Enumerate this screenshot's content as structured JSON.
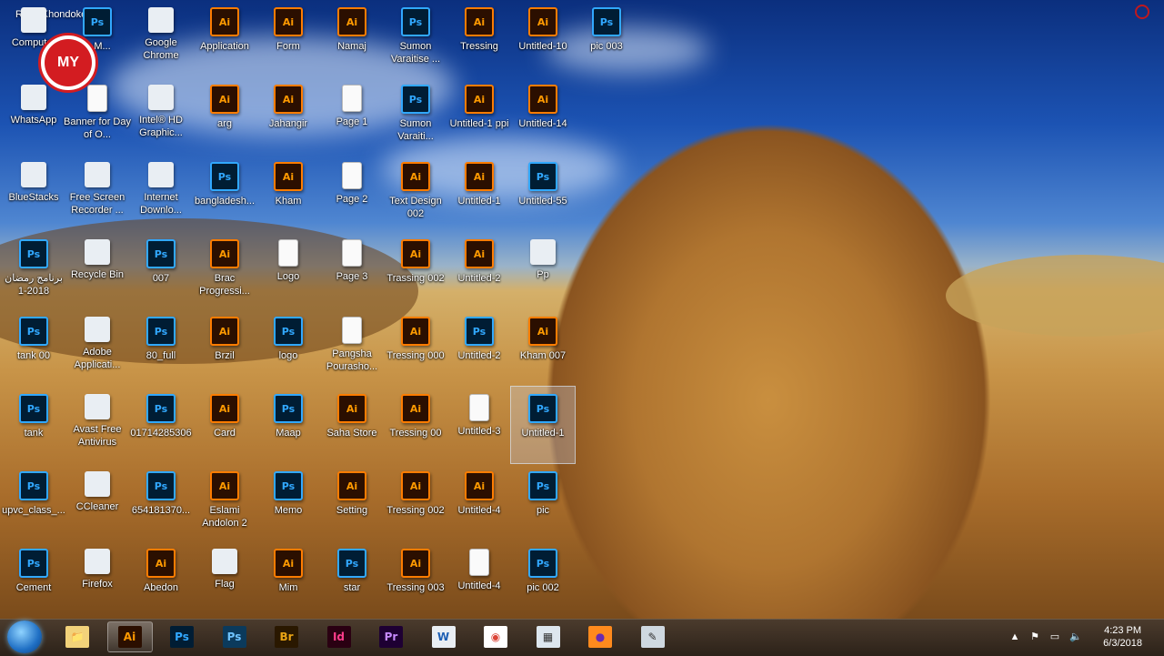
{
  "desktop": {
    "user_name": "Rony Khondoker",
    "badge_text": "MY",
    "icons": [
      {
        "label": "Computer",
        "type": "app"
      },
      {
        "label": "A-M...",
        "type": "ps"
      },
      {
        "label": "Google Chrome",
        "type": "app"
      },
      {
        "label": "Application",
        "type": "ai"
      },
      {
        "label": "Form",
        "type": "ai"
      },
      {
        "label": "Namaj",
        "type": "ai"
      },
      {
        "label": "Sumon Varaitise ...",
        "type": "ps"
      },
      {
        "label": "Tressing",
        "type": "ai"
      },
      {
        "label": "Untitled-10",
        "type": "ai"
      },
      {
        "label": "pic 003",
        "type": "ps"
      },
      {
        "label": "WhatsApp",
        "type": "app"
      },
      {
        "label": "Banner for Day of O...",
        "type": "doc"
      },
      {
        "label": "Intel® HD Graphic...",
        "type": "app"
      },
      {
        "label": "arg",
        "type": "ai"
      },
      {
        "label": "Jahangir",
        "type": "ai"
      },
      {
        "label": "Page 1",
        "type": "doc"
      },
      {
        "label": "Sumon Varaiti...",
        "type": "ps"
      },
      {
        "label": "Untitled-1 ppi",
        "type": "ai"
      },
      {
        "label": "Untitled-14",
        "type": "ai"
      },
      {
        "label": "BlueStacks",
        "type": "app"
      },
      {
        "label": "Free Screen Recorder ...",
        "type": "app"
      },
      {
        "label": "Internet Downlo...",
        "type": "app"
      },
      {
        "label": "bangladesh...",
        "type": "ps"
      },
      {
        "label": "Kham",
        "type": "ai"
      },
      {
        "label": "Page 2",
        "type": "doc"
      },
      {
        "label": "Text Design 002",
        "type": "ai"
      },
      {
        "label": "Untitled-1",
        "type": "ai"
      },
      {
        "label": "Untitled-55",
        "type": "ps"
      },
      {
        "label": "برنامج رمضان 2018-1",
        "type": "ps"
      },
      {
        "label": "Recycle Bin",
        "type": "app"
      },
      {
        "label": "007",
        "type": "ps"
      },
      {
        "label": "Brac Progressi...",
        "type": "ai"
      },
      {
        "label": "Logo",
        "type": "doc"
      },
      {
        "label": "Page 3",
        "type": "doc"
      },
      {
        "label": "Trassing 002",
        "type": "ai"
      },
      {
        "label": "Untitled-2",
        "type": "ai"
      },
      {
        "label": "Pp",
        "type": "app"
      },
      {
        "label": "tank 00",
        "type": "ps"
      },
      {
        "label": "Adobe Applicati...",
        "type": "app"
      },
      {
        "label": "80_full",
        "type": "ps"
      },
      {
        "label": "Brzil",
        "type": "ai"
      },
      {
        "label": "logo",
        "type": "ps"
      },
      {
        "label": "Pangsha Pourasho...",
        "type": "doc"
      },
      {
        "label": "Tressing 000",
        "type": "ai"
      },
      {
        "label": "Untitled-2",
        "type": "ps"
      },
      {
        "label": "Kham 007",
        "type": "ai"
      },
      {
        "label": "tank",
        "type": "ps"
      },
      {
        "label": "Avast Free Antivirus",
        "type": "app"
      },
      {
        "label": "01714285306",
        "type": "ps"
      },
      {
        "label": "Card",
        "type": "ai"
      },
      {
        "label": "Maap",
        "type": "ps"
      },
      {
        "label": "Saha Store",
        "type": "ai"
      },
      {
        "label": "Tressing 00",
        "type": "ai"
      },
      {
        "label": "Untitled-3",
        "type": "doc"
      },
      {
        "label": "Untitled-1",
        "type": "ps"
      },
      {
        "label": "upvc_class_...",
        "type": "ps"
      },
      {
        "label": "CCleaner",
        "type": "app"
      },
      {
        "label": "654181370...",
        "type": "ps"
      },
      {
        "label": "Eslami Andolon 2",
        "type": "ai"
      },
      {
        "label": "Memo",
        "type": "ps"
      },
      {
        "label": "Setting",
        "type": "ai"
      },
      {
        "label": "Tressing 002",
        "type": "ai"
      },
      {
        "label": "Untitled-4",
        "type": "ai"
      },
      {
        "label": "pic",
        "type": "ps"
      },
      {
        "label": "Cement",
        "type": "ps"
      },
      {
        "label": "Firefox",
        "type": "app"
      },
      {
        "label": "Abedon",
        "type": "ai"
      },
      {
        "label": "Flag",
        "type": "app"
      },
      {
        "label": "Mim",
        "type": "ai"
      },
      {
        "label": "star",
        "type": "ps"
      },
      {
        "label": "Tressing 003",
        "type": "ai"
      },
      {
        "label": "Untitled-4",
        "type": "doc"
      },
      {
        "label": "pic 002",
        "type": "ps"
      }
    ]
  },
  "taskbar": {
    "apps": [
      {
        "name": "explorer",
        "glyph": "📁"
      },
      {
        "name": "illustrator",
        "glyph": "Ai",
        "active": true
      },
      {
        "name": "photoshop",
        "glyph": "Ps"
      },
      {
        "name": "photoshop-2",
        "glyph": "Ps"
      },
      {
        "name": "bridge",
        "glyph": "Br"
      },
      {
        "name": "indesign",
        "glyph": "Id"
      },
      {
        "name": "premiere",
        "glyph": "Pr"
      },
      {
        "name": "word",
        "glyph": "W"
      },
      {
        "name": "chrome",
        "glyph": "◉"
      },
      {
        "name": "calculator",
        "glyph": "▦"
      },
      {
        "name": "firefox",
        "glyph": "●"
      },
      {
        "name": "tool",
        "glyph": "✎"
      }
    ],
    "clock_time": "4:23 PM",
    "clock_date": "6/3/2018"
  }
}
